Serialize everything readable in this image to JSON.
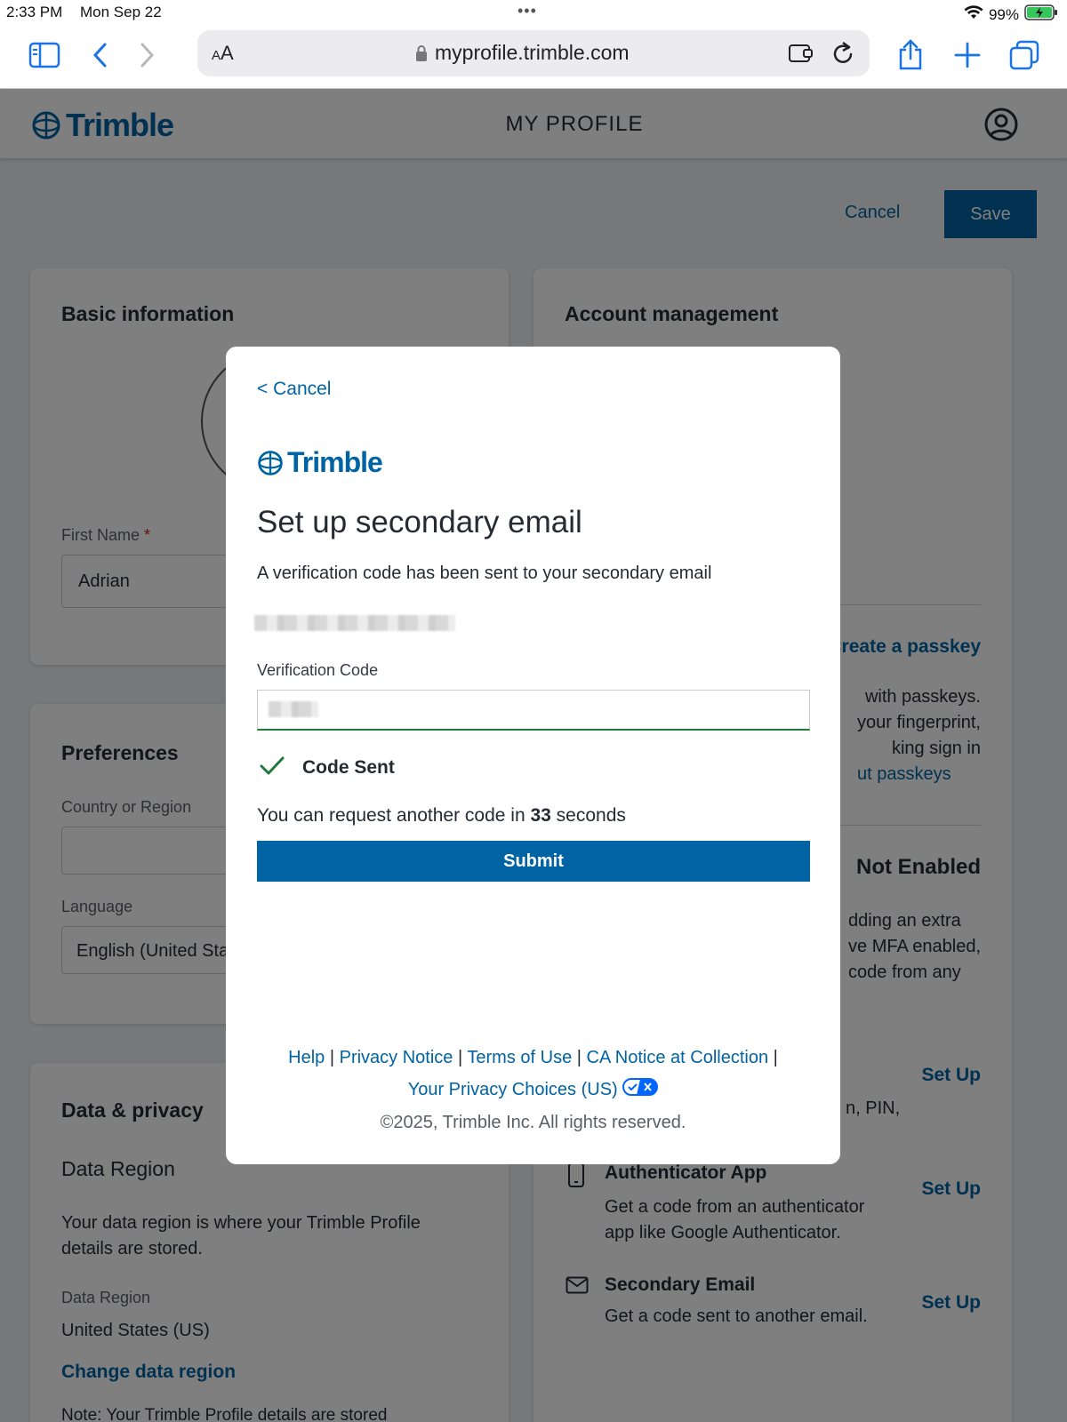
{
  "status_bar": {
    "time": "2:33 PM",
    "date": "Mon Sep 22",
    "battery": "99%",
    "dots": "•••"
  },
  "browser": {
    "text_size_label": "AA",
    "url": "myprofile.trimble.com"
  },
  "app_header": {
    "logo": "Trimble",
    "title": "MY PROFILE"
  },
  "actions": {
    "cancel": "Cancel",
    "save": "Save"
  },
  "basic_info": {
    "title": "Basic information",
    "first_name_label": "First Name",
    "required_mark": "*",
    "first_name_value": "Adrian"
  },
  "preferences": {
    "title": "Preferences",
    "country_label": "Country or Region",
    "language_label": "Language",
    "language_value": "English (United Sta"
  },
  "data_privacy": {
    "title": "Data & privacy",
    "region_heading": "Data Region",
    "region_desc": "Your data region is where your Trimble Profile details are stored.",
    "region_label": "Data Region",
    "region_value": "United States (US)",
    "change_link": "Change data region",
    "note": "Note: Your Trimble Profile details are stored"
  },
  "account_mgmt": {
    "title": "Account management",
    "create_passkey": "Create a passkey",
    "passkey_line1": "with passkeys.",
    "passkey_line2": "your fingerprint,",
    "passkey_line3": "king sign in",
    "passkey_link": "ut passkeys",
    "mfa_status": "Not Enabled",
    "mfa_line1": "dding an extra",
    "mfa_line2": "ve MFA enabled,",
    "mfa_line3": "code from any",
    "setup1": "Set Up",
    "pin_fragment": "n, PIN,",
    "auth_app_title": "Authenticator App",
    "auth_app_desc": "Get a code from an authenticator app like Google Authenticator.",
    "setup2": "Set Up",
    "sec_email_title": "Secondary Email",
    "sec_email_desc": "Get a code sent to another email.",
    "setup3": "Set Up"
  },
  "modal": {
    "cancel_link": "< Cancel",
    "logo": "Trimble",
    "title": "Set up secondary email",
    "subtitle": "A verification code has been sent to your secondary email",
    "code_label": "Verification Code",
    "status": "Code Sent",
    "resend_prefix": "You can request another code in",
    "resend_seconds": "33",
    "resend_suffix": "seconds",
    "submit": "Submit",
    "footer": {
      "help": "Help",
      "privacy": "Privacy Notice",
      "terms": "Terms of Use",
      "ca_notice": "CA Notice at Collection",
      "choices": "Your Privacy Choices (US)",
      "sep": "|",
      "copyright": "©2025, Trimble Inc. All rights reserved."
    }
  },
  "colors": {
    "brand_blue": "#0063a3",
    "success_green": "#1e7a3c",
    "overlay": "rgba(0,0,0,0.5)"
  }
}
